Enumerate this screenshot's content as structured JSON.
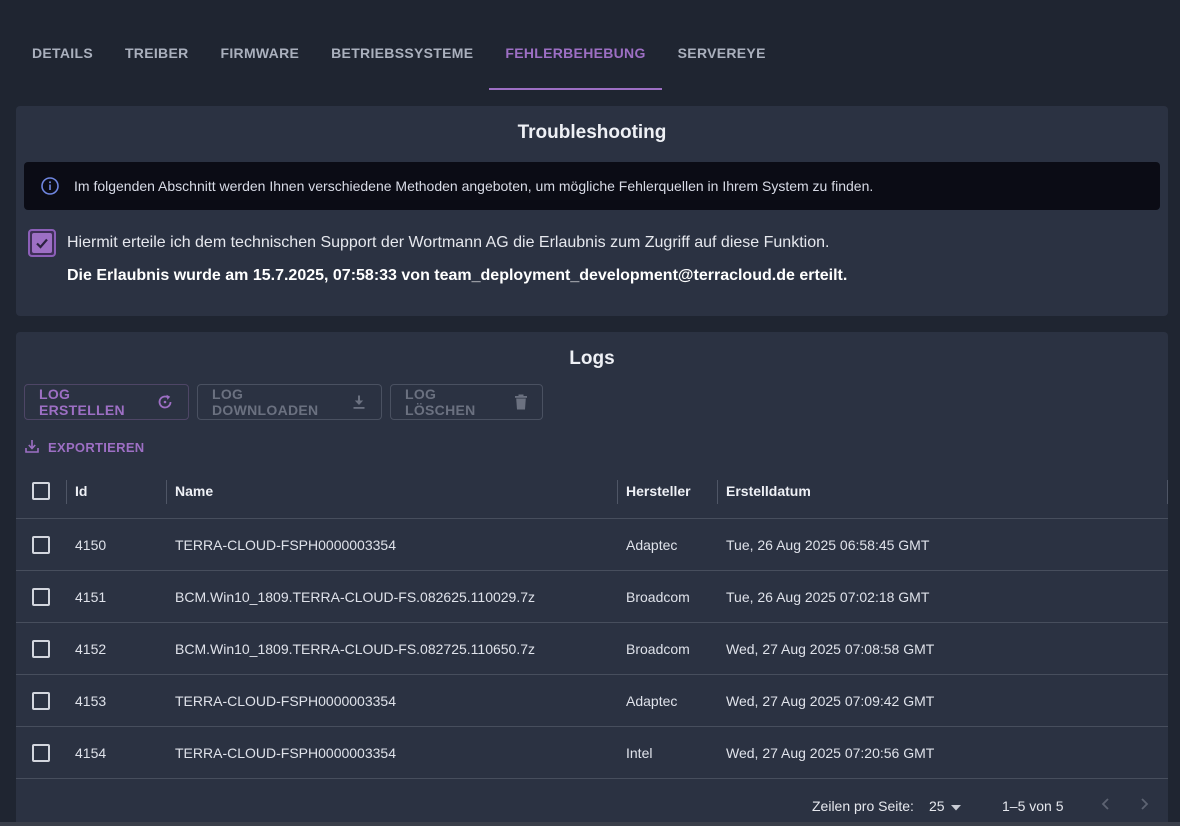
{
  "tabs": [
    {
      "label": "DETAILS",
      "active": false
    },
    {
      "label": "TREIBER",
      "active": false
    },
    {
      "label": "FIRMWARE",
      "active": false
    },
    {
      "label": "BETRIEBSSYSTEME",
      "active": false
    },
    {
      "label": "FEHLERBEHEBUNG",
      "active": true
    },
    {
      "label": "SERVEREYE",
      "active": false
    }
  ],
  "troubleshooting": {
    "title": "Troubleshooting",
    "info_text": "Im folgenden Abschnitt werden Ihnen verschiedene Methoden angeboten, um mögliche Fehlerquellen in Ihrem System zu finden.",
    "consent_label": "Hiermit erteile ich dem technischen Support der Wortmann AG die Erlaubnis zum Zugriff auf diese Funktion.",
    "consent_checked": true,
    "consent_granted_text": "Die Erlaubnis wurde am 15.7.2025, 07:58:33 von team_deployment_development@terracloud.de erteilt."
  },
  "logs": {
    "title": "Logs",
    "buttons": {
      "create": "LOG ERSTELLEN",
      "download": "LOG DOWNLOADEN",
      "delete": "LOG LÖSCHEN"
    },
    "export_label": "EXPORTIEREN",
    "columns": {
      "id": "Id",
      "name": "Name",
      "vendor": "Hersteller",
      "created": "Erstelldatum"
    },
    "rows": [
      {
        "id": "4150",
        "name": "TERRA-CLOUD-FSPH0000003354",
        "vendor": "Adaptec",
        "created": "Tue, 26 Aug 2025 06:58:45 GMT"
      },
      {
        "id": "4151",
        "name": "BCM.Win10_1809.TERRA-CLOUD-FS.082625.110029.7z",
        "vendor": "Broadcom",
        "created": "Tue, 26 Aug 2025 07:02:18 GMT"
      },
      {
        "id": "4152",
        "name": "BCM.Win10_1809.TERRA-CLOUD-FS.082725.110650.7z",
        "vendor": "Broadcom",
        "created": "Wed, 27 Aug 2025 07:08:58 GMT"
      },
      {
        "id": "4153",
        "name": "TERRA-CLOUD-FSPH0000003354",
        "vendor": "Adaptec",
        "created": "Wed, 27 Aug 2025 07:09:42 GMT"
      },
      {
        "id": "4154",
        "name": "TERRA-CLOUD-FSPH0000003354",
        "vendor": "Intel",
        "created": "Wed, 27 Aug 2025 07:20:56 GMT"
      }
    ],
    "pagination": {
      "rows_per_page_label": "Zeilen pro Seite:",
      "rows_per_page": "25",
      "range": "1–5 von 5"
    }
  },
  "colors": {
    "accent": "#9d6fc4",
    "background": "#1f2531",
    "card": "#2b3242",
    "alert_bg": "#0b0c15"
  },
  "icons": {
    "info": "info-circle-icon",
    "refresh": "refresh-icon",
    "download": "download-icon",
    "delete": "trash-icon",
    "export": "export-icon",
    "checkmark": "checkmark-icon",
    "dropdown": "caret-down-icon",
    "prev": "chevron-left-icon",
    "next": "chevron-right-icon"
  }
}
